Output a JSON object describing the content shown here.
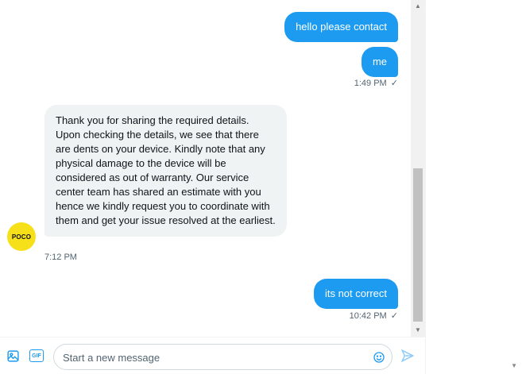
{
  "messages": [
    {
      "type": "sent",
      "text": "hello please contact"
    },
    {
      "type": "sent",
      "text": "me",
      "time": "1:49 PM",
      "status": "✓"
    },
    {
      "type": "received",
      "text": "Thank you for sharing the required details. Upon checking the details, we see that there are dents on your device. Kindly note that any physical damage to the device will be considered as out of warranty. Our service center team has shared an estimate with you hence we kindly request you to coordinate with them and get your issue resolved at the earliest.",
      "time": "7:12 PM"
    },
    {
      "type": "sent",
      "text": "its not correct",
      "time": "10:42 PM",
      "status": "✓"
    }
  ],
  "avatar": {
    "label": "POCO",
    "color": "#f6e01a"
  },
  "composer": {
    "placeholder": "Start a new message",
    "gif_label": "GIF"
  },
  "colors": {
    "accent": "#1d9bf0",
    "received_bubble": "#eff3f4"
  },
  "icons": [
    "image-icon",
    "gif-icon",
    "emoji-icon",
    "send-icon"
  ]
}
